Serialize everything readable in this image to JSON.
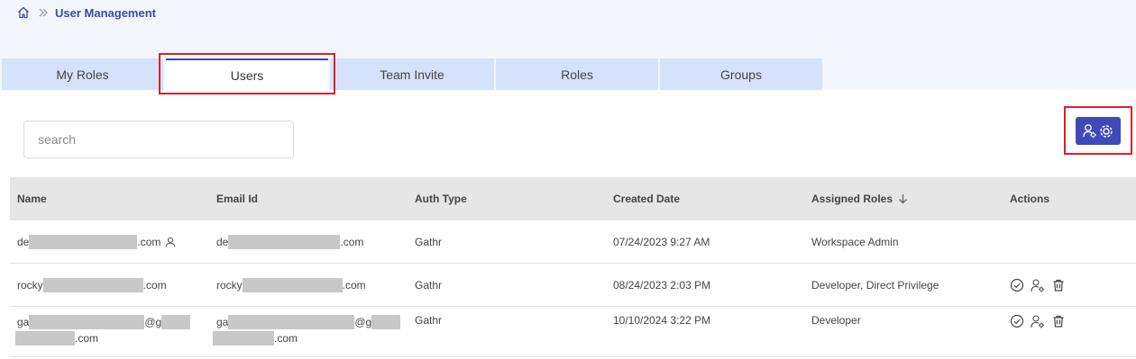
{
  "breadcrumb": {
    "home_icon": "home-icon",
    "separator_icon": "double-chevron-right-icon",
    "title": "User Management"
  },
  "tabs": [
    {
      "label": "My Roles",
      "active": false
    },
    {
      "label": "Users",
      "active": true
    },
    {
      "label": "Team Invite",
      "active": false
    },
    {
      "label": "Roles",
      "active": false
    },
    {
      "label": "Groups",
      "active": false
    }
  ],
  "search": {
    "placeholder": "search",
    "value": ""
  },
  "toolbar": {
    "role_settings_icon": "user-settings-icon"
  },
  "table": {
    "columns": [
      "Name",
      "Email Id",
      "Auth Type",
      "Created Date",
      "Assigned Roles",
      "Actions"
    ],
    "sort_column": "Assigned Roles",
    "sort_direction": "descending",
    "rows": [
      {
        "name_prefix": "de",
        "name_suffix": ".com",
        "email_prefix": "de",
        "email_suffix": ".com",
        "auth": "Gathr",
        "created": "07/24/2023 9:27 AM",
        "roles": "Workspace Admin",
        "current_user": true,
        "actions": []
      },
      {
        "name_prefix": "rocky",
        "name_suffix": ".com",
        "email_prefix": "rocky",
        "email_suffix": ".com",
        "auth": "Gathr",
        "created": "08/24/2023 2:03 PM",
        "roles": "Developer, Direct Privilege",
        "current_user": false,
        "actions": [
          "check-circle-icon",
          "user-settings-icon",
          "trash-icon"
        ]
      },
      {
        "name_prefix": "ga",
        "name_mid": "@g",
        "name_suffix": ".com",
        "email_prefix": "ga",
        "email_mid": "@g",
        "email_suffix": ".com",
        "auth": "Gathr",
        "created": "10/10/2024 3:22 PM",
        "roles": "Developer",
        "current_user": false,
        "actions": [
          "check-circle-icon",
          "user-settings-icon",
          "trash-icon"
        ]
      }
    ]
  },
  "colors": {
    "accent": "#3f4a9e",
    "button": "#3f4ab6",
    "tab_bg": "#d6e2fb",
    "highlight": "#d9222a"
  }
}
